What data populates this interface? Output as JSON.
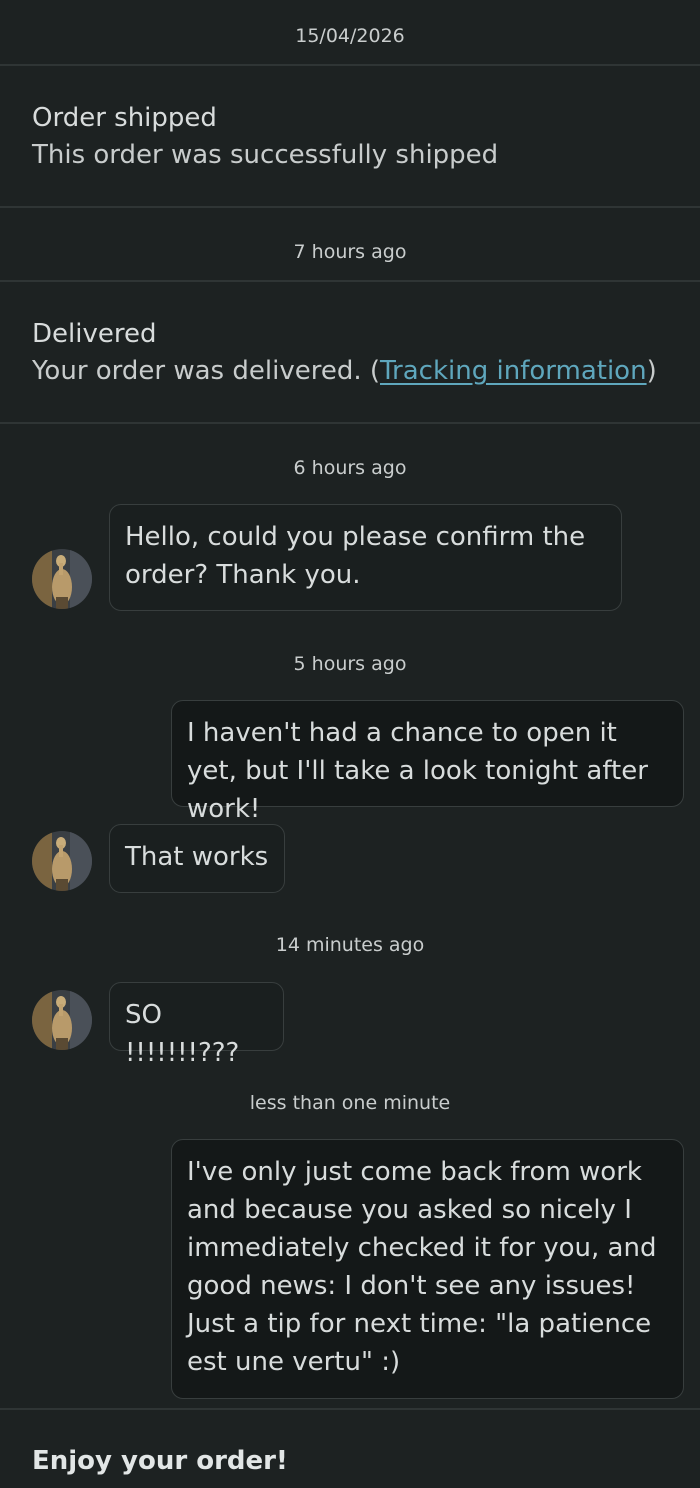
{
  "date_header": "15/04/2026",
  "events": [
    {
      "title": "Order shipped",
      "body": "This order was successfully shipped"
    },
    {
      "title": "Delivered",
      "body_prefix": "Your order was delivered. (",
      "link": "Tracking information",
      "body_suffix": ")"
    }
  ],
  "timestamps": {
    "t1": "7 hours ago",
    "t2": "6 hours ago",
    "t3": "5 hours ago",
    "t4": "14 minutes ago",
    "t5": "less than one minute"
  },
  "messages": [
    {
      "from": "seller",
      "text": "Hello, could you please confirm the order? Thank you."
    },
    {
      "from": "me",
      "text": "I haven't had a chance to open it yet, but I'll take a look tonight after work!"
    },
    {
      "from": "seller",
      "text": "That works"
    },
    {
      "from": "seller",
      "text": "SO !!!!!!!???"
    },
    {
      "from": "me",
      "text": "I've only just come back from work and because you asked so nicely I immediately checked it for you, and good news: I don't see any issues! Just a tip for next time: \"la patience est une vertu\" :)"
    }
  ],
  "footer": "Enjoy your order!",
  "colors": {
    "background": "#1d2222",
    "link": "#5fa7bd",
    "bubble_border": "#383e3e"
  }
}
